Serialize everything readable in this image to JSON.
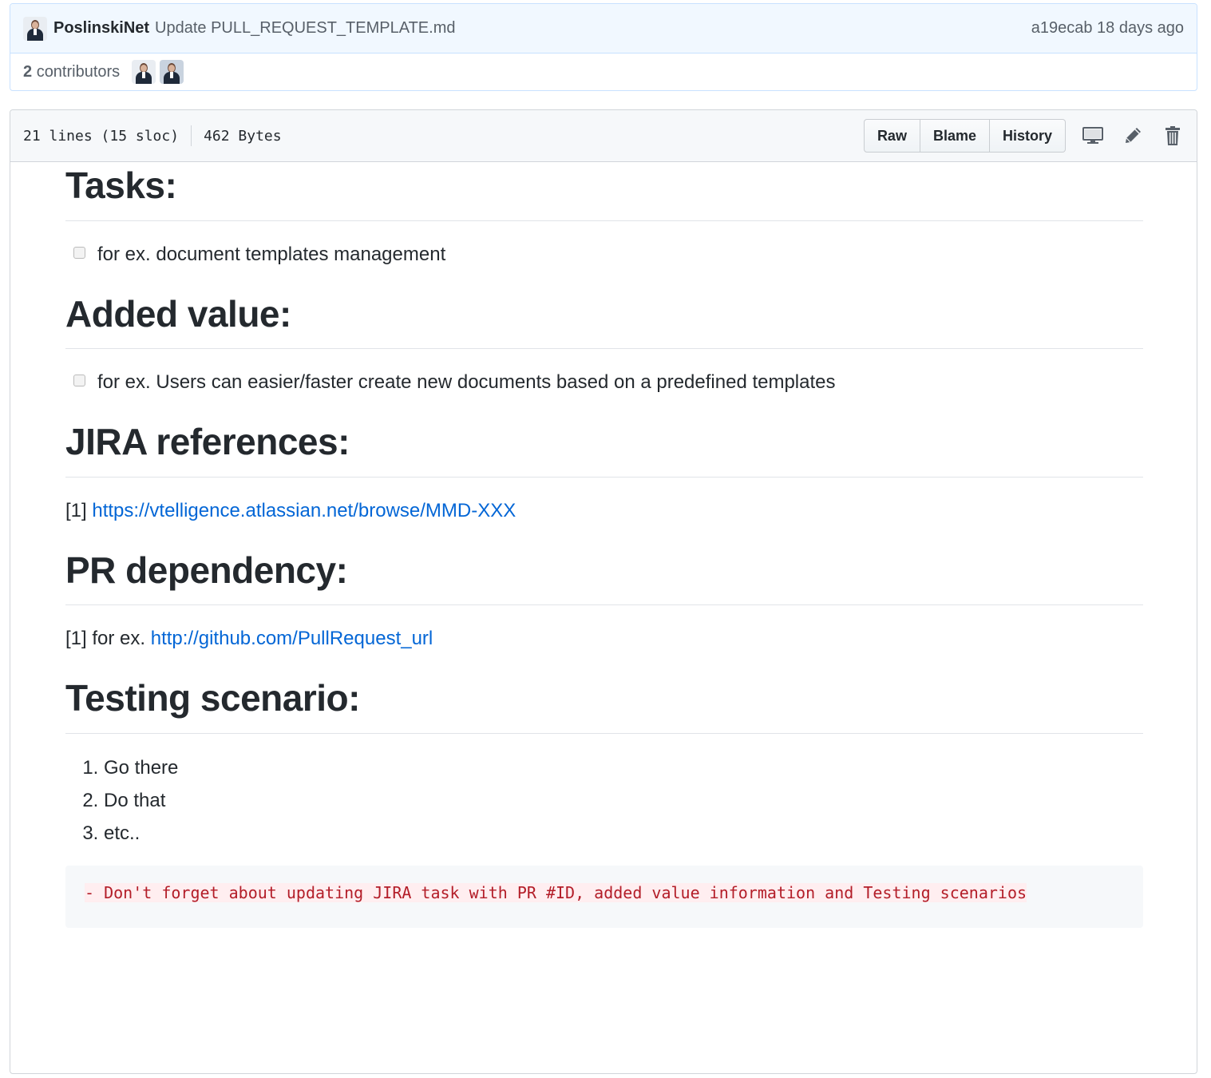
{
  "commit": {
    "author": "PoslinskiNet",
    "message": "Update PULL_REQUEST_TEMPLATE.md",
    "sha": "a19ecab",
    "time": "18 days ago"
  },
  "contributors": {
    "count": "2",
    "label": "contributors"
  },
  "file": {
    "lines": "21 lines (15 sloc)",
    "size": "462 Bytes",
    "buttons": {
      "raw": "Raw",
      "blame": "Blame",
      "history": "History"
    },
    "icons": [
      "desktop-icon",
      "pencil-icon",
      "trash-icon"
    ]
  },
  "content": {
    "tasks_heading": "Tasks:",
    "tasks_item": "for ex. document templates management",
    "value_heading": "Added value:",
    "value_item": "for ex. Users can easier/faster create new documents based on a predefined templates",
    "jira_heading": "JIRA references:",
    "jira_prefix": "[1]",
    "jira_link": "https://vtelligence.atlassian.net/browse/MMD-XXX",
    "pr_heading": "PR dependency:",
    "pr_prefix": "[1] for ex.",
    "pr_link": "http://github.com/PullRequest_url",
    "testing_heading": "Testing scenario:",
    "testing_steps": [
      "Go there",
      "Do that",
      "etc.."
    ],
    "code_line": "- Don't forget about updating JIRA task with PR #ID, added value information and Testing scenarios"
  },
  "colors": {
    "link": "#0366d6",
    "commit_bg": "#f1f8ff",
    "deletion_text": "#b31d28"
  }
}
